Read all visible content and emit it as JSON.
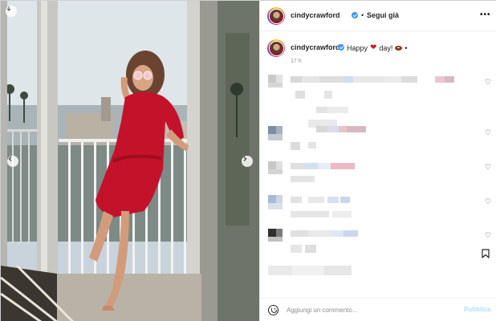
{
  "post": {
    "username": "cindycrawford",
    "follow_separator": "•",
    "follow_label": "Segui già",
    "more_icon": "more-options-icon",
    "caption_username": "cindycrawford",
    "caption_text": "Happy",
    "caption_text_after": "day!",
    "caption_emoji_heart": "❤",
    "caption_emoji_football": "football-emoji",
    "caption_bullet": "•",
    "timestamp": "17 h"
  },
  "comment_bar": {
    "placeholder": "Aggiungi un commento...",
    "publish_label": "Pubblica"
  },
  "colors": {
    "verified": "#3897f0",
    "publish_disabled": "#b2dffc",
    "dress": "#c4122a",
    "heart": "#d1152b"
  }
}
